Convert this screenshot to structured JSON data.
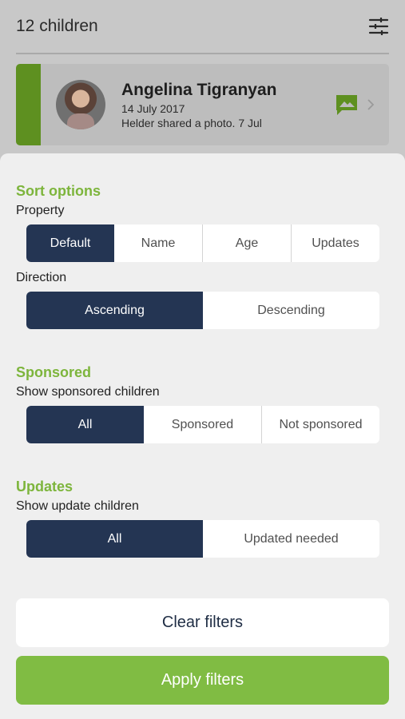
{
  "header": {
    "title": "12 children",
    "filter_icon": "filter-sliders-icon"
  },
  "child_card": {
    "name": "Angelina Tigranyan",
    "dob": "14 July 2017",
    "update": "Helder shared a photo. 7 Jul",
    "accent_color": "#5e9020",
    "icons": {
      "photo": "photo-icon",
      "chevron": "chevron-right-icon"
    }
  },
  "sort": {
    "title": "Sort options",
    "property_label": "Property",
    "property_options": [
      "Default",
      "Name",
      "Age",
      "Updates"
    ],
    "property_selected": "Default",
    "direction_label": "Direction",
    "direction_options": [
      "Ascending",
      "Descending"
    ],
    "direction_selected": "Ascending"
  },
  "sponsored": {
    "title": "Sponsored",
    "label": "Show sponsored children",
    "options": [
      "All",
      "Sponsored",
      "Not sponsored"
    ],
    "selected": "All"
  },
  "updates": {
    "title": "Updates",
    "label": "Show update children",
    "options": [
      "All",
      "Updated needed"
    ],
    "selected": "All"
  },
  "actions": {
    "clear": "Clear filters",
    "apply": "Apply filters"
  },
  "colors": {
    "accent_green": "#80bc43",
    "title_green": "#7db53c",
    "selected_navy": "#243553"
  }
}
